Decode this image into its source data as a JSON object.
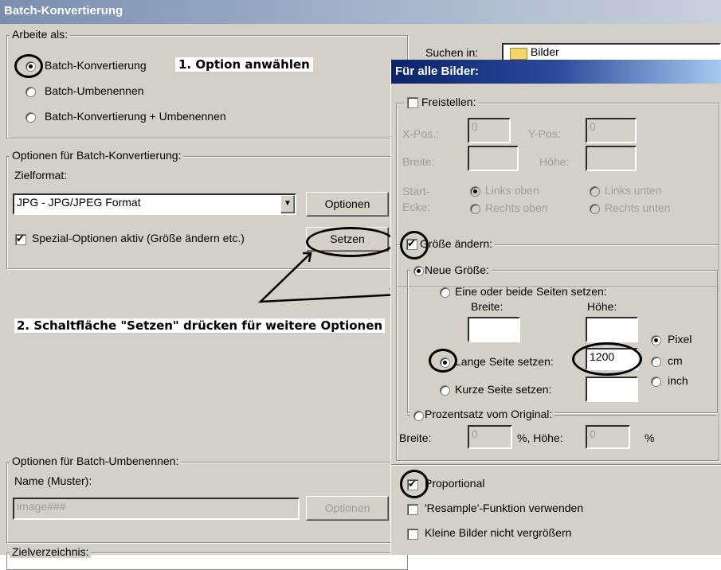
{
  "window": {
    "title": "Batch-Konvertierung"
  },
  "arbeite": {
    "legend": "Arbeite als:",
    "options": [
      "Batch-Konvertierung",
      "Batch-Umbenennen",
      "Batch-Konvertierung + Umbenennen"
    ]
  },
  "konv": {
    "legend": "Optionen für Batch-Konvertierung:",
    "zielformat_label": "Zielformat:",
    "format_value": "JPG - JPG/JPEG Format",
    "optionen_button": "Optionen",
    "spezial_label": "Spezial-Optionen aktiv (Größe ändern etc.)",
    "setzen_button": "Setzen"
  },
  "umbenennen": {
    "legend": "Optionen für Batch-Umbenennen:",
    "name_label": "Name (Muster):",
    "name_value": "image###",
    "optionen_button": "Optionen"
  },
  "zielverzeichnis_label": "Zielverzeichnis:",
  "suchen_label": "Suchen in:",
  "suchen_value": "Bilder",
  "annotations": {
    "step1": "1. Option anwählen",
    "step2": "2. Schaltfläche \"Setzen\" drücken für weitere Optionen"
  },
  "dialog": {
    "title": "Für alle Bilder:",
    "freistellen": {
      "label": "Freistellen:",
      "xpos_label": "X-Pos.:",
      "xpos_value": "0",
      "ypos_label": "Y-Pos:",
      "ypos_value": "0",
      "breite_label": "Breite:",
      "hoehe_label": "Höhe:",
      "start_label": "Start-",
      "ecke_label": "Ecke:",
      "corners": [
        "Links oben",
        "Links unten",
        "Rechts oben",
        "Rechts unten"
      ]
    },
    "groesse": {
      "label": "Größe ändern:",
      "neue_label": "Neue Größe:",
      "eine_label": "Eine oder beide Seiten setzen:",
      "breite_label": "Breite:",
      "hoehe_label": "Höhe:",
      "lange_label": "Lange Seite setzen:",
      "lange_value": "1200",
      "kurze_label": "Kurze Seite setzen:",
      "units": [
        "Pixel",
        "cm",
        "inch"
      ],
      "prozent_label": "Prozentsatz vom Original:",
      "p_breite_label": "Breite:",
      "p_breite_value": "0",
      "p_pct1": "%, Höhe:",
      "p_hoehe_value": "0",
      "p_pct2": "%"
    },
    "proportional": "Proportional",
    "resample": "'Resample'-Funktion verwenden",
    "kleine": "Kleine Bilder nicht vergrößern"
  }
}
